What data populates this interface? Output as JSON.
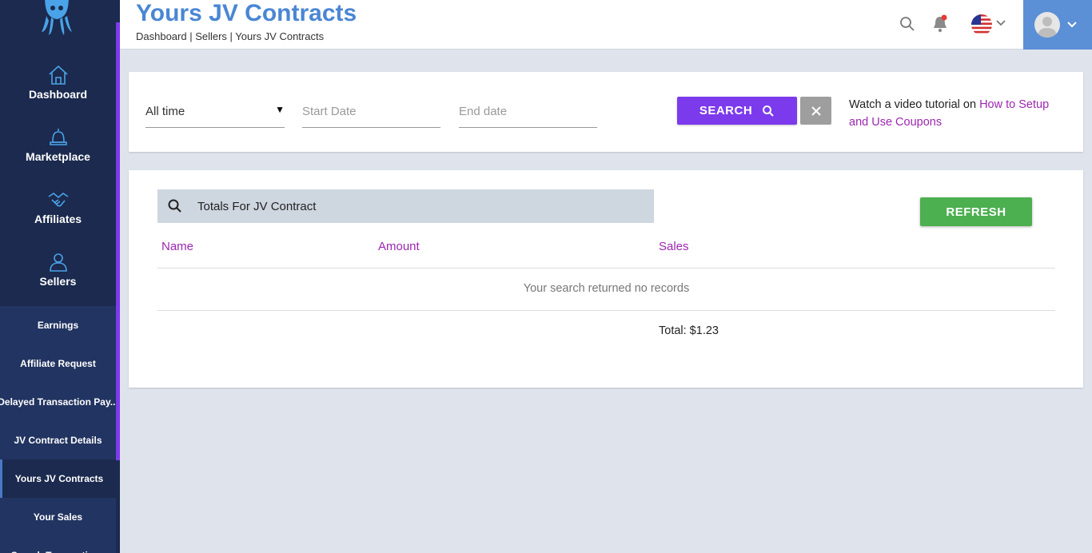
{
  "sidebar": {
    "main": [
      {
        "label": "Dashboard",
        "icon": "home-icon"
      },
      {
        "label": "Marketplace",
        "icon": "bell-icon"
      },
      {
        "label": "Affiliates",
        "icon": "handshake-icon"
      },
      {
        "label": "Sellers",
        "icon": "users-icon"
      }
    ],
    "sub": [
      {
        "label": "Earnings"
      },
      {
        "label": "Affiliate Request"
      },
      {
        "label": "Delayed Transaction Pay..."
      },
      {
        "label": "JV Contract Details"
      },
      {
        "label": "Yours JV Contracts",
        "active": true
      },
      {
        "label": "Your Sales"
      },
      {
        "label": "Search Transactions"
      }
    ]
  },
  "header": {
    "title": "Yours JV Contracts",
    "breadcrumb": "Dashboard | Sellers | Yours JV Contracts",
    "accent": "#4a86d4"
  },
  "filters": {
    "period": "All time",
    "start_placeholder": "Start Date",
    "end_placeholder": "End date",
    "search_label": "SEARCH",
    "tutorial_text": "Watch a video tutorial on ",
    "tutorial_link": "How to Setup and Use Coupons"
  },
  "results": {
    "search_value": "Totals For JV Contract",
    "refresh_label": "REFRESH",
    "columns": {
      "name": "Name",
      "amount": "Amount",
      "sales": "Sales"
    },
    "empty_message": "Your search returned no records",
    "total": "Total: $1.23"
  },
  "colors": {
    "primary": "#7c3aed",
    "link": "#9c27b0",
    "success": "#4caf50",
    "sidebar": "#1b2a4e"
  }
}
